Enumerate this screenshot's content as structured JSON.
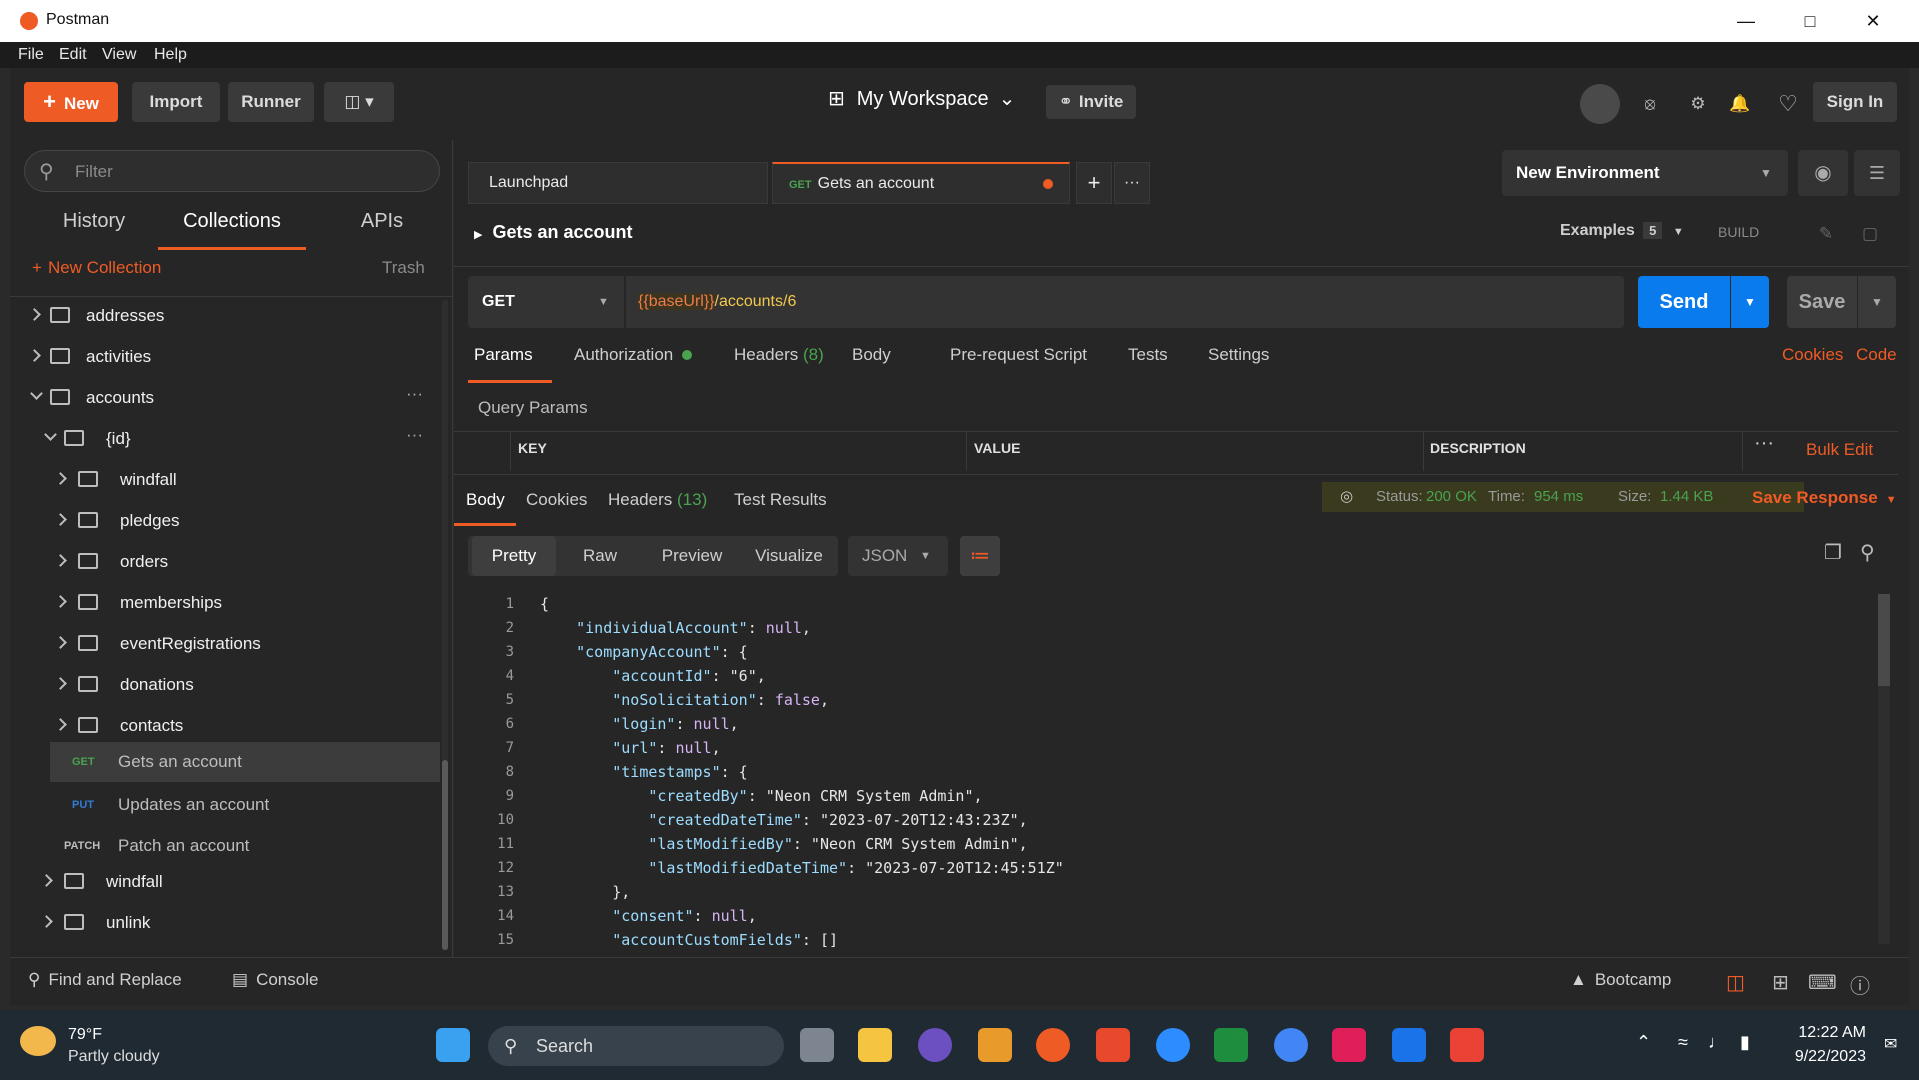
{
  "window": {
    "title": "Postman"
  },
  "menu": [
    "File",
    "Edit",
    "View",
    "Help"
  ],
  "header": {
    "new_label": "New",
    "import_label": "Import",
    "runner_label": "Runner",
    "workspace_label": "My Workspace",
    "invite_label": "Invite",
    "signin_label": "Sign In"
  },
  "sidebar": {
    "filter_placeholder": "Filter",
    "tabs": [
      "History",
      "Collections",
      "APIs"
    ],
    "new_collection_label": "New Collection",
    "trash_label": "Trash",
    "tree": [
      {
        "label": "addresses"
      },
      {
        "label": "activities"
      },
      {
        "label": "accounts"
      },
      {
        "label": "{id}"
      },
      {
        "label": "windfall"
      },
      {
        "label": "pledges"
      },
      {
        "label": "orders"
      },
      {
        "label": "memberships"
      },
      {
        "label": "eventRegistrations"
      },
      {
        "label": "donations"
      },
      {
        "label": "contacts"
      },
      {
        "label": "Gets an account",
        "method": "GET"
      },
      {
        "label": "Updates an account",
        "method": "PUT"
      },
      {
        "label": "Patch an account",
        "method": "PATCH"
      },
      {
        "label": "windfall"
      },
      {
        "label": "unlink"
      }
    ]
  },
  "tabs": {
    "launchpad": "Launchpad",
    "active_method": "GET",
    "active_title": "Gets an account"
  },
  "environment": {
    "selected": "New Environment"
  },
  "request": {
    "name": "Gets an account",
    "examples_label": "Examples",
    "examples_count": "5",
    "build_label": "BUILD",
    "method": "GET",
    "url_var": "{{baseUrl}}",
    "url_path": "/accounts/6",
    "send_label": "Send",
    "save_label": "Save",
    "tabs": {
      "params": "Params",
      "authorization": "Authorization",
      "headers": "Headers",
      "headers_count": "(8)",
      "body": "Body",
      "prerequest": "Pre-request Script",
      "tests": "Tests",
      "settings": "Settings"
    },
    "cookies_label": "Cookies",
    "code_label": "Code",
    "query_params_label": "Query Params",
    "columns": [
      "KEY",
      "VALUE",
      "DESCRIPTION"
    ],
    "bulk_edit_label": "Bulk Edit"
  },
  "response": {
    "tabs": {
      "body": "Body",
      "cookies": "Cookies",
      "headers": "Headers",
      "headers_count": "(13)",
      "test_results": "Test Results"
    },
    "status_label": "Status:",
    "status_value": "200 OK",
    "time_label": "Time:",
    "time_value": "954 ms",
    "size_label": "Size:",
    "size_value": "1.44 KB",
    "save_response_label": "Save Response",
    "view_modes": [
      "Pretty",
      "Raw",
      "Preview",
      "Visualize"
    ],
    "format": "JSON",
    "code_lines": [
      "{",
      "    \"individualAccount\": null,",
      "    \"companyAccount\": {",
      "        \"accountId\": \"6\",",
      "        \"noSolicitation\": false,",
      "        \"login\": null,",
      "        \"url\": null,",
      "        \"timestamps\": {",
      "            \"createdBy\": \"Neon CRM System Admin\",",
      "            \"createdDateTime\": \"2023-07-20T12:43:23Z\",",
      "            \"lastModifiedBy\": \"Neon CRM System Admin\",",
      "            \"lastModifiedDateTime\": \"2023-07-20T12:45:51Z\"",
      "        },",
      "        \"consent\": null,",
      "        \"accountCustomFields\": []"
    ]
  },
  "statusbar": {
    "find_replace_label": "Find and Replace",
    "console_label": "Console",
    "bootcamp_label": "Bootcamp"
  },
  "taskbar": {
    "weather_temp": "79°F",
    "weather_desc": "Partly cloudy",
    "search_placeholder": "Search",
    "time": "12:22 AM",
    "date": "9/22/2023"
  },
  "colors": {
    "accent": "#ef5b25",
    "send_blue": "#097bed",
    "status_green": "#49a34f",
    "get_green": "#49a34f",
    "put_blue": "#2f7bd6"
  }
}
